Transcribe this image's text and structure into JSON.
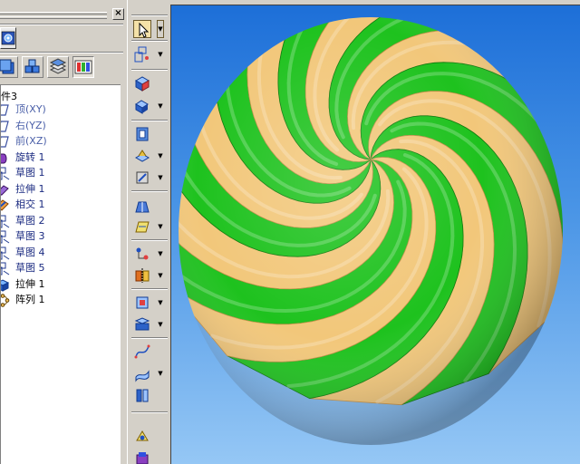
{
  "panel": {
    "close_label": "×"
  },
  "feature_tree": {
    "root_label": "件3",
    "items": [
      {
        "label": "顶(XY)",
        "kind": "plane",
        "icon": "plane-icon"
      },
      {
        "label": "右(YZ)",
        "kind": "plane",
        "icon": "plane-icon"
      },
      {
        "label": "前(XZ)",
        "kind": "plane",
        "icon": "plane-icon"
      },
      {
        "label": "旋转 1",
        "kind": "feat",
        "icon": "revolve-icon"
      },
      {
        "label": "草图 1",
        "kind": "feat",
        "icon": "sketch-icon"
      },
      {
        "label": "拉伸 1",
        "kind": "feat",
        "icon": "extrude-icon"
      },
      {
        "label": "相交 1",
        "kind": "feat",
        "icon": "intersect-icon"
      },
      {
        "label": "草图 2",
        "kind": "feat",
        "icon": "sketch-icon"
      },
      {
        "label": "草图 3",
        "kind": "feat",
        "icon": "sketch-icon"
      },
      {
        "label": "草图 4",
        "kind": "feat",
        "icon": "sketch-icon"
      },
      {
        "label": "草图 5",
        "kind": "feat",
        "icon": "sketch-icon"
      },
      {
        "label": "拉伸 1",
        "kind": "active",
        "icon": "extrude-solid-icon"
      },
      {
        "label": "阵列 1",
        "kind": "active",
        "icon": "pattern-icon"
      }
    ]
  },
  "colors": {
    "stripe_green": "#1ec21e",
    "stripe_tan": "#f2c77a",
    "background_top": "#1d6fd8",
    "background_bottom": "#95c7f5",
    "panel_gray": "#d4d0c8"
  },
  "toolbar": {
    "tools": [
      {
        "name": "select-tool",
        "icon": "cursor-arrow-icon",
        "dropdown": true
      },
      {
        "name": "sketch-tool",
        "icon": "sketch-icon",
        "dropdown": true
      },
      {
        "name": "extrude-tool",
        "icon": "extrude-icon",
        "dropdown": false
      },
      {
        "name": "revolve-tool",
        "icon": "revolve-icon",
        "dropdown": true
      },
      {
        "name": "hole-tool",
        "icon": "hole-icon",
        "dropdown": false
      },
      {
        "name": "round-tool",
        "icon": "round-icon",
        "dropdown": true
      },
      {
        "name": "chamfer-tool",
        "icon": "chamfer-icon",
        "dropdown": true
      },
      {
        "name": "loft-tool",
        "icon": "loft-icon",
        "dropdown": false
      },
      {
        "name": "plane-tool",
        "icon": "plane-icon",
        "dropdown": true
      },
      {
        "name": "pattern-tool",
        "icon": "pattern-icon",
        "dropdown": true
      },
      {
        "name": "mirror-tool",
        "icon": "mirror-icon",
        "dropdown": true
      },
      {
        "name": "shell-tool",
        "icon": "shell-icon",
        "dropdown": true
      },
      {
        "name": "thicken-tool",
        "icon": "thicken-icon",
        "dropdown": true
      },
      {
        "name": "curve-tool",
        "icon": "curve-icon",
        "dropdown": false
      },
      {
        "name": "surface-tool",
        "icon": "surface-icon",
        "dropdown": true
      },
      {
        "name": "split-tool",
        "icon": "split-icon",
        "dropdown": false
      },
      {
        "name": "view-tool",
        "icon": "view-icon",
        "dropdown": false
      },
      {
        "name": "material-tool",
        "icon": "material-icon",
        "dropdown": false
      }
    ]
  },
  "model": {
    "stripe_count": 16,
    "twist_degrees": 150
  }
}
